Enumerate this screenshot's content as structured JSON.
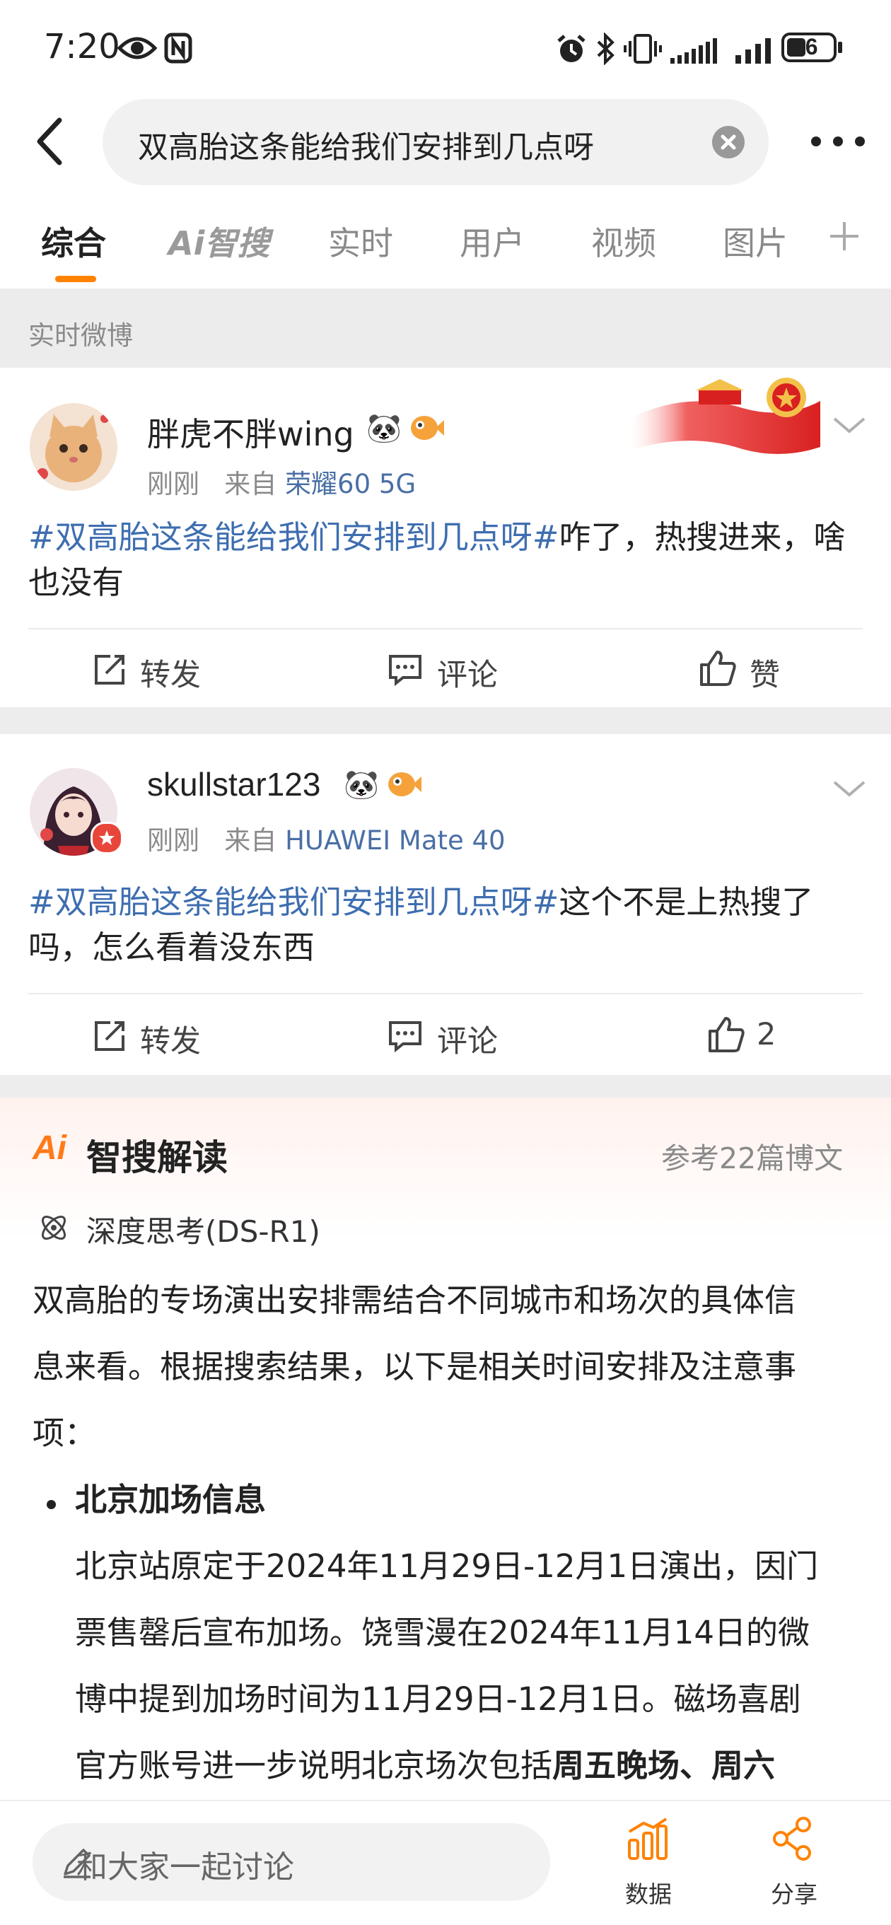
{
  "status_bar": {
    "time": "7:20",
    "battery": "36",
    "icons": [
      "eye-icon",
      "nfc-icon",
      "alarm-icon",
      "bluetooth-icon",
      "vibrate-icon",
      "signal-icon",
      "battery-icon"
    ]
  },
  "search": {
    "query": "双高胎这条能给我们安排到几点呀"
  },
  "tabs": [
    {
      "label": "综合",
      "active": true
    },
    {
      "label": "Ai智搜",
      "active": false
    },
    {
      "label": "实时",
      "active": false
    },
    {
      "label": "用户",
      "active": false
    },
    {
      "label": "视频",
      "active": false
    },
    {
      "label": "图片",
      "active": false
    }
  ],
  "section": {
    "title": "实时微博"
  },
  "posts": [
    {
      "username": "胖虎不胖wing",
      "time": "刚刚",
      "from_label": "来自",
      "source": "荣耀60 5G",
      "hashtag": "#双高胎这条能给我们安排到几点呀#",
      "text": "咋了，热搜进来，啥也没有",
      "repost_label": "转发",
      "comment_label": "评论",
      "like_label": "赞"
    },
    {
      "username": "skullstar123",
      "time": "刚刚",
      "from_label": "来自",
      "source": "HUAWEI Mate 40",
      "hashtag": "#双高胎这条能给我们安排到几点呀#",
      "text": "这个不是上热搜了吗，怎么看着没东西",
      "repost_label": "转发",
      "comment_label": "评论",
      "like_label": "2"
    }
  ],
  "ai": {
    "logo": "Ai",
    "title": "智搜解读",
    "reference": "参考22篇博文",
    "deep_think": "深度思考(DS-R1)",
    "intro_lines": [
      "双高胎的专场演出安排需结合不同城市和场次的具体信",
      "息来看。根据搜索结果，以下是相关时间安排及注意事",
      "项："
    ],
    "bullet_title": "北京加场信息",
    "bullet_lines": [
      "北京站原定于2024年11月29日-12月1日演出，因门",
      "票售罄后宣布加场。饶雪漫在2024年11月14日的微",
      "博中提到加场时间为11月29日-12月1日。磁场喜剧"
    ],
    "bullet_last_prefix": "官方账号进一步说明北京场次包括",
    "bullet_last_bold": "周五晚场、周六"
  },
  "bottom_bar": {
    "comment_placeholder": "和大家一起讨论",
    "data_label": "数据",
    "share_label": "分享"
  },
  "colors": {
    "accent": "#ff8200",
    "link": "#3e6eb0"
  }
}
